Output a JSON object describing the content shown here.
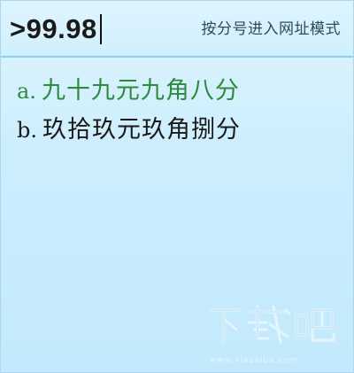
{
  "composition": {
    "text": ">99.98"
  },
  "header": {
    "hint": "按分号进入网址模式"
  },
  "candidates": [
    {
      "index": "a.",
      "text": "九十九元九角八分"
    },
    {
      "index": "b.",
      "text": "玖拾玖元玖角捌分"
    }
  ],
  "watermark": {
    "logo_text": "下载吧",
    "url": "www.xiazaiba.com"
  },
  "colors": {
    "background": "#c8ecfc",
    "header_border": "#8fd0ee",
    "selected_candidate": "#2e8b3e",
    "normal_candidate": "#1a1a1a"
  },
  "icons": {
    "caret": "text-caret-icon",
    "watermark": "xiazaiba-logo-icon"
  }
}
